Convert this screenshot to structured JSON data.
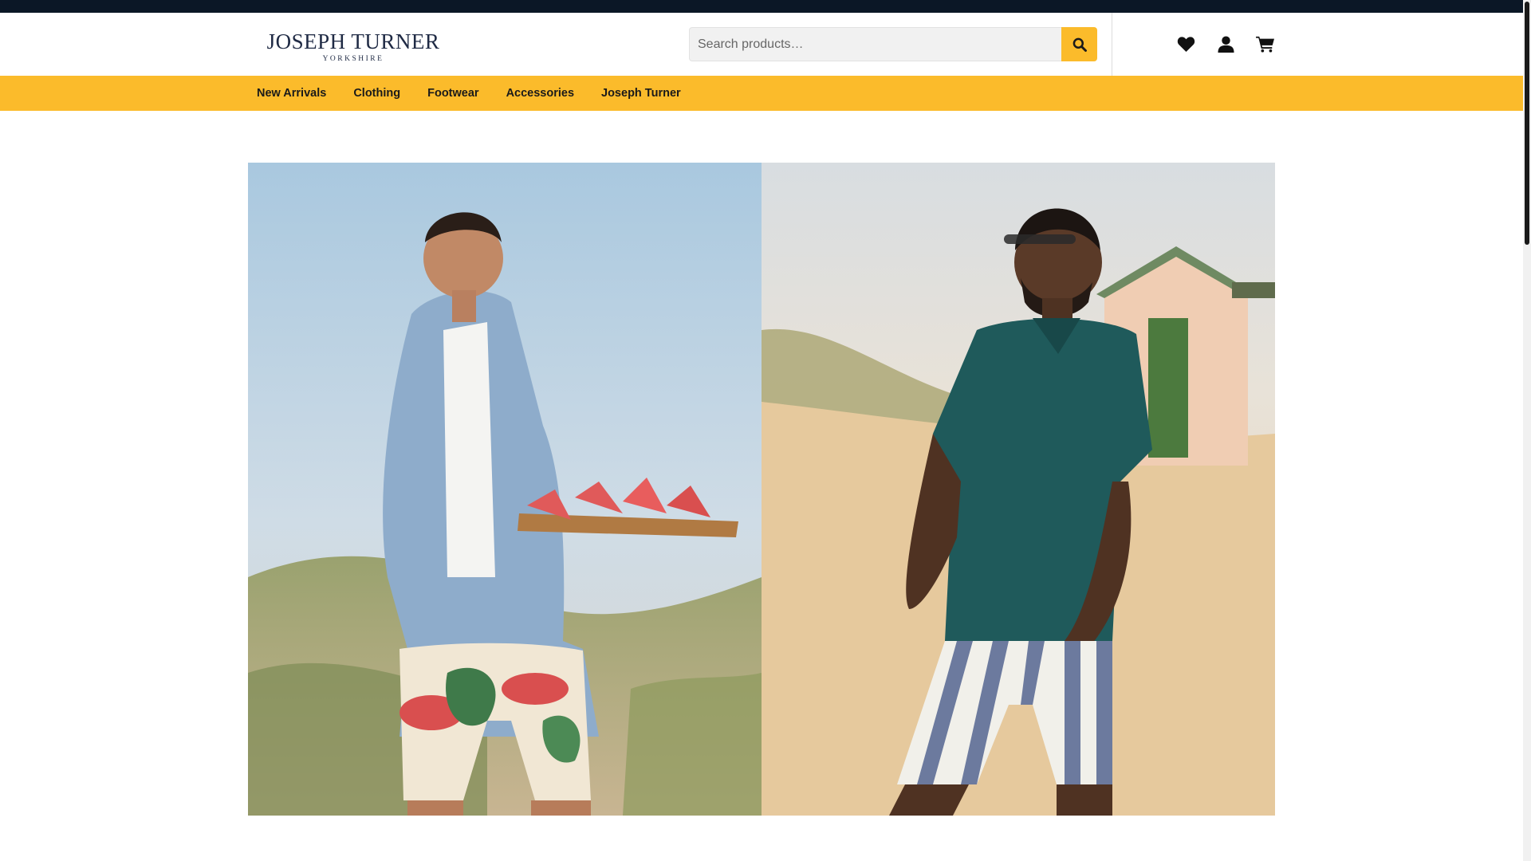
{
  "brand": {
    "name": "JOSEPH TURNER",
    "tagline": "YORKSHIRE",
    "accent_color": "#fbbb2b",
    "topbar_color": "#0b1726"
  },
  "search": {
    "placeholder": "Search products…",
    "button_icon": "search-icon"
  },
  "header_icons": [
    {
      "name": "wishlist",
      "icon": "heart-icon"
    },
    {
      "name": "account",
      "icon": "user-icon"
    },
    {
      "name": "cart",
      "icon": "cart-icon"
    }
  ],
  "nav": {
    "items": [
      {
        "label": "New Arrivals"
      },
      {
        "label": "Clothing"
      },
      {
        "label": "Footwear"
      },
      {
        "label": "Accessories"
      },
      {
        "label": "Joseph Turner"
      }
    ]
  },
  "hero": {
    "panels": [
      {
        "subject": "man with denim shirt holding watermelon board on beach"
      },
      {
        "subject": "man in teal polo and striped shorts by beach hut"
      }
    ]
  }
}
